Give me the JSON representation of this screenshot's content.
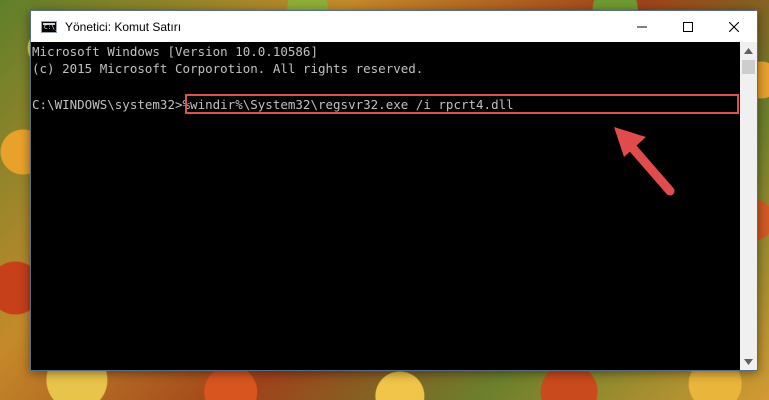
{
  "window": {
    "title": "Yönetici: Komut Satırı",
    "icon_text": "C:\\_",
    "controls": {
      "minimize_icon": "minimize-icon",
      "maximize_icon": "maximize-icon",
      "close_icon": "close-icon"
    }
  },
  "console": {
    "lines": [
      "Microsoft Windows [Version 10.0.10586]",
      "(c) 2015 Microsoft Corporotion. All rights reserved."
    ],
    "prompt": "C:\\WINDOWS\\system32>",
    "command": "%windir%\\System32\\regsvr32.exe /i rpcrt4.dll"
  },
  "annotation": {
    "arrow_icon": "red-arrow-icon",
    "highlight_color": "#d9534f"
  },
  "colors": {
    "console_bg": "#000000",
    "console_text": "#c0c0c0",
    "accent_red": "#e04b4b"
  }
}
